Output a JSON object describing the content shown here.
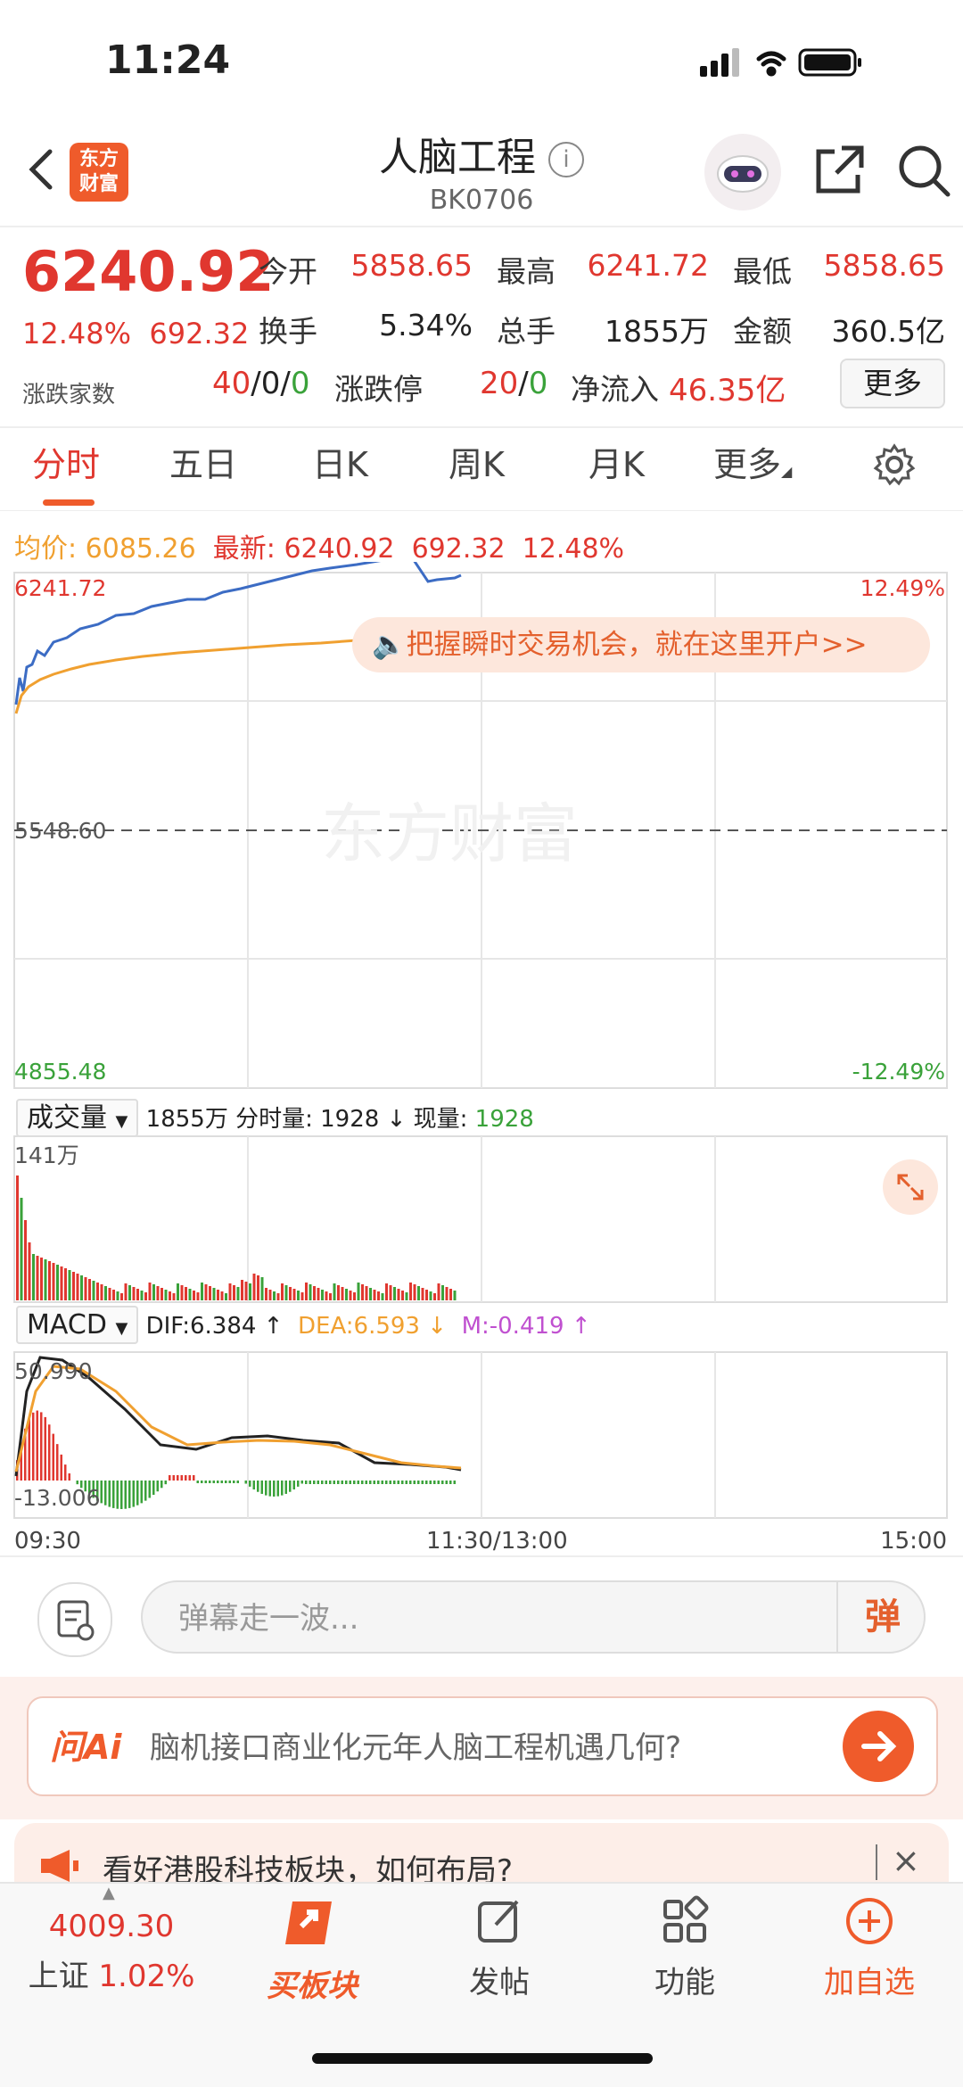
{
  "status": {
    "time": "11:24"
  },
  "nav": {
    "logo_line1": "东方",
    "logo_line2": "财富",
    "title": "人脑工程",
    "code": "BK0706"
  },
  "quote": {
    "price": "6240.92",
    "change_pct": "12.48%",
    "change_abs": "692.32",
    "open_label": "今开",
    "open": "5858.65",
    "high_label": "最高",
    "high": "6241.72",
    "low_label": "最低",
    "low": "5858.65",
    "turnover_label": "换手",
    "turnover": "5.34%",
    "volume_label": "总手",
    "volume": "1855万",
    "amount_label": "金额",
    "amount": "360.5亿",
    "updown_label": "涨跌家数",
    "up": "40",
    "sep1": "/",
    "flat": "0",
    "sep2": "/",
    "down": "0",
    "limit_label": "涨跌停",
    "limit_up": "20",
    "sep3": "/",
    "limit_down": "0",
    "inflow_label": "净流入",
    "inflow": "46.35亿",
    "more": "更多"
  },
  "tabs": [
    "分时",
    "五日",
    "日K",
    "周K",
    "月K",
    "更多"
  ],
  "intraday": {
    "avg_label": "均价:",
    "avg": "6085.26",
    "latest_label": "最新:",
    "latest": "6240.92",
    "latest_abs": "692.32",
    "latest_pct": "12.48%",
    "y_top": "6241.72",
    "y_mid": "5548.60",
    "y_bot": "4855.48",
    "pct_top": "12.49%",
    "pct_bot": "-12.49%",
    "banner": "把握瞬时交易机会，就在这里开户>>",
    "watermark": "东方财富"
  },
  "volume": {
    "selector": "成交量",
    "total": "1855万",
    "minute_label": "分时量:",
    "minute": "1928",
    "arrow": "↓",
    "now_label": "现量:",
    "now": "1928",
    "max": "141万"
  },
  "macd": {
    "selector": "MACD",
    "dif": "DIF:6.384 ↑",
    "dea": "DEA:6.593 ↓",
    "m": "M:-0.419 ↑",
    "top": "50.990",
    "bot": "-13.006"
  },
  "time_axis": {
    "start": "09:30",
    "mid": "11:30/13:00",
    "end": "15:00"
  },
  "comment": {
    "placeholder": "弹幕走一波...",
    "danmu": "弹"
  },
  "ai": {
    "brand": "问Ai",
    "question": "脑机接口商业化元年人脑工程机遇几何?"
  },
  "notice": {
    "text": "看好港股科技板块，如何布局?"
  },
  "bottom": {
    "index_value": "4009.30",
    "index_name": "上证",
    "index_pct": "1.02%",
    "buy": "买板块",
    "post": "发帖",
    "func": "功能",
    "watch": "加自选"
  },
  "colors": {
    "up": "#e0372f",
    "down": "#3aa23a",
    "price_line": "#3c6cc4",
    "avg_line": "#f0a030",
    "accent": "#ef5b2b"
  }
}
